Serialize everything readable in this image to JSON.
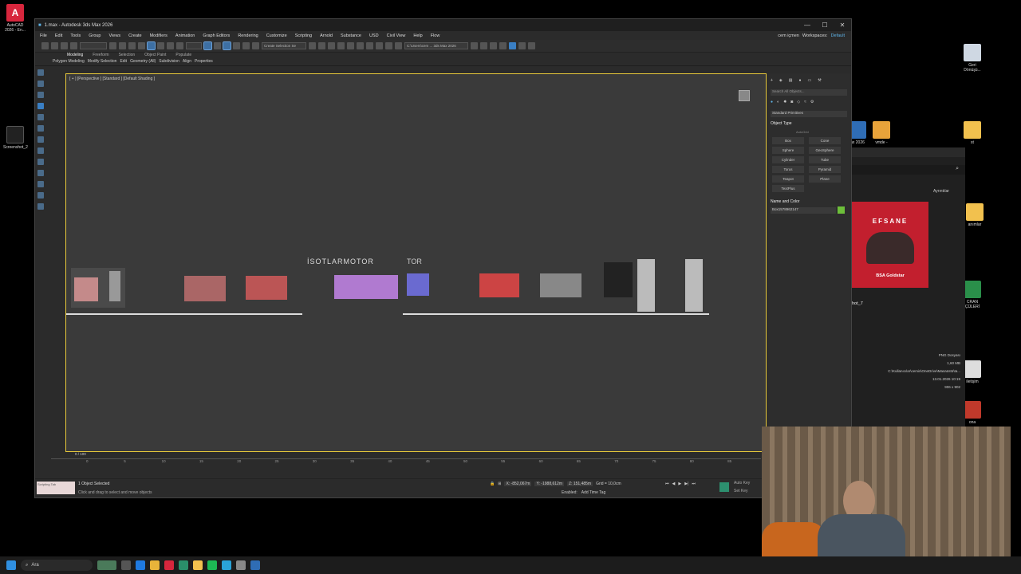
{
  "window": {
    "title": "1.max - Autodesk 3ds Max 2026",
    "controls": [
      "—",
      "☐",
      "✕"
    ]
  },
  "menu": {
    "items": [
      "File",
      "Edit",
      "Tools",
      "Group",
      "Views",
      "Create",
      "Modifiers",
      "Animation",
      "Graph Editors",
      "Rendering",
      "Customize",
      "Scripting",
      "Arnold",
      "Substance",
      "USD",
      "Civil View",
      "Help",
      "Flow"
    ],
    "user": "cem içmen",
    "workspaces_label": "Workspaces:",
    "workspace": "Default"
  },
  "toolbar": {
    "selection_set": "Create Selection Se",
    "path": "C:\\Users\\cem ... 3ds Max 2026"
  },
  "ribbon": {
    "tabs": [
      "Modeling",
      "Freeform",
      "Selection",
      "Object Paint",
      "Populate"
    ],
    "sub": [
      "Polygon Modeling",
      "Modify Selection",
      "Edit",
      "Geometry (All)",
      "Subdivision",
      "Align",
      "Properties"
    ]
  },
  "viewport": {
    "label": "[ + ] [Perspective ] [Standard ] [Default Shading ]",
    "sign_text": "İSOTLARMOTOR",
    "sign_text2": "TOR"
  },
  "command_panel": {
    "search_placeholder": "Search All Objects...",
    "dropdown": "Standard Primitives",
    "object_type_title": "Object Type",
    "autogrid": "AutoGrid",
    "buttons": [
      "Box",
      "Cone",
      "Sphere",
      "GeoSphere",
      "Cylinder",
      "Tube",
      "Torus",
      "Pyramid",
      "Teapot",
      "Plane",
      "TextPlus"
    ],
    "name_color_title": "Name and Color",
    "object_name": "Box1578962147",
    "object_color": "#6dbf3a"
  },
  "timeline": {
    "frame": "0 / 100",
    "ticks": [
      "0",
      "5",
      "10",
      "15",
      "20",
      "25",
      "30",
      "35",
      "40",
      "45",
      "50",
      "55",
      "60",
      "65",
      "70",
      "75",
      "80",
      "85",
      "90",
      "95",
      "100"
    ]
  },
  "status": {
    "selected": "1 Object Selected",
    "prompt": "Click and drag to select and move objects",
    "x": "X: -852,067m",
    "y": "Y: -1988,612m",
    "z": "Z: 151,485m",
    "grid": "Grid = 10,0cm",
    "add_time_tag": "Add Time Tag",
    "enabled": "Enabled:",
    "auto_key": "Auto Key",
    "set_key": "Set Key",
    "script_mini": "Scripting Tab"
  },
  "explorer": {
    "details": "Ayrıntılar",
    "ad_title": "EFSANE",
    "ad_caption": "BSA Goldstar",
    "file_partial": "hot_7",
    "file_type": "PNG Dosyası",
    "file_size": "1,60 MB",
    "file_path": "C:\\Kullanıcılar\\cemis\\OneDrive\\Masaüstü\\ta...",
    "file_date": "13.01.2026 10:19",
    "file_dims": "906 x 902"
  },
  "desktop": {
    "left_icons": [
      {
        "label": "AutoCAD 2026 - En...",
        "color": "#d7263d"
      },
      {
        "label": "Screenshot_2",
        "color": "#333"
      }
    ],
    "right_icons": [
      {
        "label": "Geri Dönüşü...",
        "color": "#cfd8e3"
      },
      {
        "label": "vmde -",
        "color": "#e8a33a"
      },
      {
        "label": "ax 2026",
        "color": "#2f6db5"
      },
      {
        "label": "st",
        "color": "#f2c14e"
      },
      {
        "label": "anımlar",
        "color": "#f2c14e"
      },
      {
        "label": "CRAN ÇÜLERİ",
        "color": "#2a8f4a"
      },
      {
        "label": "iletişim",
        "color": "#ddd"
      },
      {
        "label": "ona",
        "color": "#c0392b"
      }
    ]
  },
  "taskbar": {
    "search_label": "Ara"
  }
}
